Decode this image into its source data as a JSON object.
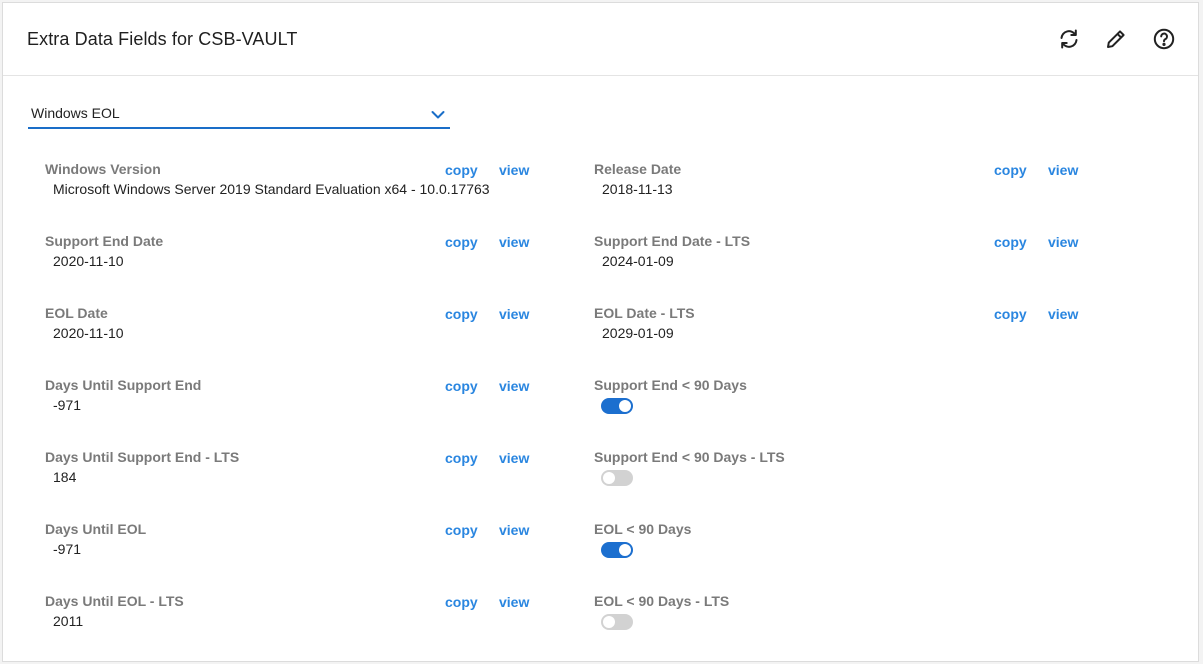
{
  "header": {
    "title": "Extra Data Fields for CSB-VAULT"
  },
  "dropdown": {
    "selected": "Windows EOL"
  },
  "links": {
    "copy": "copy",
    "view": "view"
  },
  "left_fields": [
    {
      "label": "Windows Version",
      "value": "Microsoft Windows Server 2019 Standard Evaluation x64 - 10.0.17763"
    },
    {
      "label": "Support End Date",
      "value": "2020-11-10"
    },
    {
      "label": "EOL Date",
      "value": "2020-11-10"
    },
    {
      "label": "Days Until Support End",
      "value": "-971"
    },
    {
      "label": "Days Until Support End - LTS",
      "value": "184"
    },
    {
      "label": "Days Until EOL",
      "value": "-971"
    },
    {
      "label": "Days Until EOL - LTS",
      "value": "2011"
    }
  ],
  "right_fields": [
    {
      "label": "Release Date",
      "value": "2018-11-13"
    },
    {
      "label": "Support End Date - LTS",
      "value": "2024-01-09"
    },
    {
      "label": "EOL Date - LTS",
      "value": "2029-01-09"
    }
  ],
  "right_toggles": [
    {
      "label": "Support End < 90 Days",
      "checked": true
    },
    {
      "label": "Support End < 90 Days - LTS",
      "checked": false
    },
    {
      "label": "EOL < 90 Days",
      "checked": true
    },
    {
      "label": "EOL < 90 Days - LTS",
      "checked": false
    }
  ],
  "colors": {
    "accent": "#1a6ec8",
    "link": "#2a86e0",
    "label": "#7a7a7a",
    "toggle_on": "#1c6fcf",
    "toggle_off": "#d2d2d2"
  }
}
